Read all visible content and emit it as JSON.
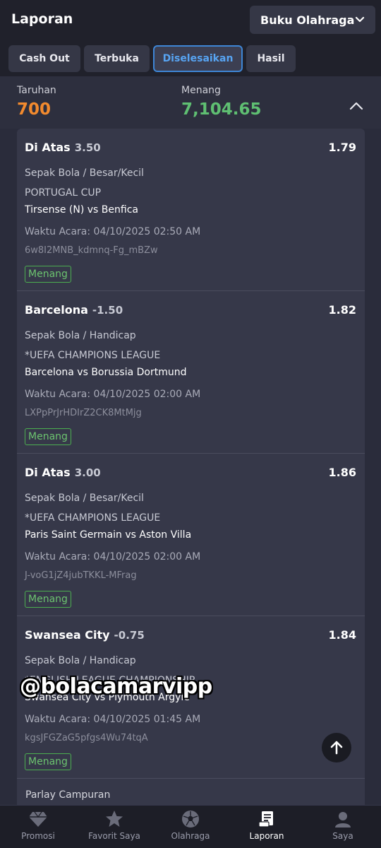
{
  "header": {
    "title": "Laporan",
    "book_label": "Buku Olahraga"
  },
  "tabs": [
    {
      "label": "Cash Out"
    },
    {
      "label": "Terbuka"
    },
    {
      "label": "Diselesaikan"
    },
    {
      "label": "Hasil"
    }
  ],
  "summary": {
    "stake_label": "Taruhan",
    "stake_value": "700",
    "win_label": "Menang",
    "win_value": "7,104.65"
  },
  "bets": [
    {
      "pick": "Di Atas",
      "handicap": "3.50",
      "odds": "1.79",
      "sport": "Sepak Bola / Besar/Kecil",
      "league": "PORTUGAL CUP",
      "match": "Tirsense (N) vs Benfica",
      "time": "Waktu Acara: 04/10/2025 02:50 AM",
      "ref": "6w8I2MNB_kdmnq-Fg_mBZw",
      "status": "Menang"
    },
    {
      "pick": "Barcelona",
      "handicap": "-1.50",
      "odds": "1.82",
      "sport": "Sepak Bola / Handicap",
      "league": "*UEFA CHAMPIONS LEAGUE",
      "match": "Barcelona vs Borussia Dortmund",
      "time": "Waktu Acara: 04/10/2025 02:00 AM",
      "ref": "LXPpPrJrHDIrZ2CK8MtMjg",
      "status": "Menang"
    },
    {
      "pick": "Di Atas",
      "handicap": "3.00",
      "odds": "1.86",
      "sport": "Sepak Bola / Besar/Kecil",
      "league": "*UEFA CHAMPIONS LEAGUE",
      "match": "Paris Saint Germain vs Aston Villa",
      "time": "Waktu Acara: 04/10/2025 02:00 AM",
      "ref": "J-voG1jZ4jubTKKL-MFrag",
      "status": "Menang"
    },
    {
      "pick": "Swansea City",
      "handicap": "-0.75",
      "odds": "1.84",
      "sport": "Sepak Bola / Handicap",
      "league": "*ENGLISH LEAGUE CHAMPIONSHIP",
      "match": "Swansea City vs Plymouth Argyle",
      "time": "Waktu Acara: 04/10/2025 01:45 AM",
      "ref": "kgsJFGZaG5pfgs4Wu74tqA",
      "status": "Menang"
    }
  ],
  "parlay_label": "Parlay Campuran",
  "watermark": "@bolacamarvipp",
  "nav": [
    {
      "label": "Promosi",
      "icon": "diamond-icon"
    },
    {
      "label": "Favorit Saya",
      "icon": "star-icon"
    },
    {
      "label": "Olahraga",
      "icon": "soccer-ball-icon"
    },
    {
      "label": "Laporan",
      "icon": "report-icon"
    },
    {
      "label": "Saya",
      "icon": "user-icon"
    }
  ],
  "colors": {
    "stake": "#f28a2e",
    "win": "#5fbf72",
    "accent": "#3e86d6",
    "status": "#4caf50"
  }
}
